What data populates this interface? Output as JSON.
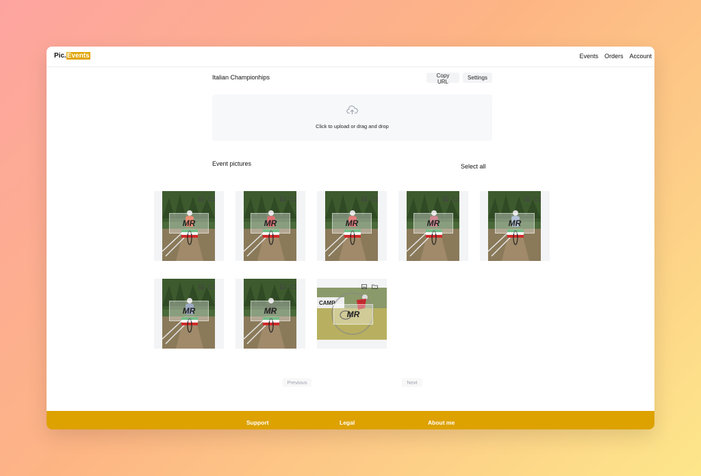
{
  "header": {
    "brand_prefix": "Pic.",
    "brand_highlight": "Events",
    "nav": [
      "Events",
      "Orders",
      "Account"
    ]
  },
  "event": {
    "title": "Italian Championhips",
    "copy_url_label": "Copy URL",
    "settings_label": "Settings"
  },
  "upload": {
    "text": "Click to upload or drag and drop"
  },
  "gallery": {
    "title": "Event pictures",
    "select_all_label": "Select all",
    "watermark": "MR",
    "photos": [
      {
        "orientation": "portrait",
        "jersey": "#e0522a"
      },
      {
        "orientation": "portrait",
        "jersey": "#c8262b"
      },
      {
        "orientation": "portrait",
        "jersey": "#d43a3a"
      },
      {
        "orientation": "portrait",
        "jersey": "#b84a5a"
      },
      {
        "orientation": "portrait",
        "jersey": "#8aa0c0"
      },
      {
        "orientation": "portrait",
        "jersey": "#6a7fa8"
      },
      {
        "orientation": "portrait",
        "jersey": "#3a4a2a"
      },
      {
        "orientation": "landscape",
        "jersey": "#c42a30",
        "banner_text": "CAMP"
      }
    ]
  },
  "pagination": {
    "previous_label": "Previous",
    "next_label": "Next"
  },
  "footer": {
    "links": [
      "Support",
      "Legal",
      "About me"
    ]
  },
  "colors": {
    "accent": "#dda100",
    "upload_bg": "#f6f8fa"
  }
}
